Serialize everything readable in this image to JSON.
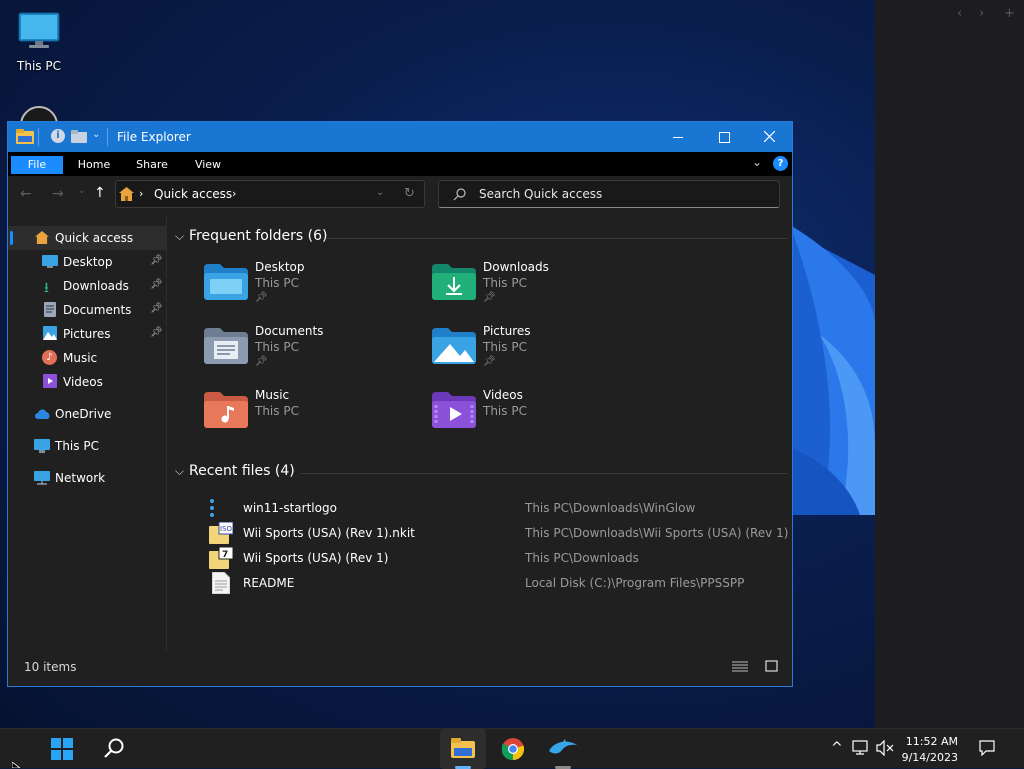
{
  "desktop": {
    "icons": [
      {
        "label": "This PC"
      }
    ]
  },
  "window": {
    "title": "File Explorer",
    "ribbon_tabs": {
      "file": "File",
      "home": "Home",
      "share": "Share",
      "view": "View"
    },
    "address_crumb": "Quick access",
    "search_placeholder": "Search Quick access",
    "status": "10 items"
  },
  "sidebar": {
    "items": [
      {
        "label": "Quick access",
        "icon": "home-icon",
        "color": "#e8a33d"
      },
      {
        "label": "Desktop",
        "icon": "desktop-icon",
        "color": "#3aa3e3",
        "pinned": true
      },
      {
        "label": "Downloads",
        "icon": "download-icon",
        "color": "#2dbf7a",
        "pinned": true
      },
      {
        "label": "Documents",
        "icon": "documents-icon",
        "color": "#9aa7b8",
        "pinned": true
      },
      {
        "label": "Pictures",
        "icon": "pictures-icon",
        "color": "#3aa3e3",
        "pinned": true
      },
      {
        "label": "Music",
        "icon": "music-icon",
        "color": "#e27058"
      },
      {
        "label": "Videos",
        "icon": "videos-icon",
        "color": "#8b52d9"
      },
      {
        "label": "OneDrive",
        "icon": "onedrive-icon",
        "color": "#2a86e0"
      },
      {
        "label": "This PC",
        "icon": "this-pc-icon",
        "color": "#3aa3e3"
      },
      {
        "label": "Network",
        "icon": "network-icon",
        "color": "#3aa3e3"
      }
    ]
  },
  "frequent": {
    "heading": "Frequent folders (6)",
    "folders": [
      {
        "name": "Desktop",
        "location": "This PC",
        "pinned": true,
        "icon": "desktop-folder-icon",
        "color": "#3aa3e3"
      },
      {
        "name": "Downloads",
        "location": "This PC",
        "pinned": true,
        "icon": "downloads-folder-icon",
        "color": "#22b07a"
      },
      {
        "name": "Documents",
        "location": "This PC",
        "pinned": true,
        "icon": "documents-folder-icon",
        "color": "#8d9bb0"
      },
      {
        "name": "Pictures",
        "location": "This PC",
        "pinned": true,
        "icon": "pictures-folder-icon",
        "color": "#3aa3e3"
      },
      {
        "name": "Music",
        "location": "This PC",
        "pinned": false,
        "icon": "music-folder-icon",
        "color": "#e8785a"
      },
      {
        "name": "Videos",
        "location": "This PC",
        "pinned": false,
        "icon": "videos-folder-icon",
        "color": "#8b52d9"
      }
    ]
  },
  "recent": {
    "heading": "Recent files (4)",
    "files": [
      {
        "name": "win11-startlogo",
        "path": "This PC\\Downloads\\WinGlow",
        "icon": "generic-file-icon"
      },
      {
        "name": "Wii Sports (USA) (Rev 1).nkit",
        "path": "This PC\\Downloads\\Wii Sports (USA) (Rev 1)",
        "icon": "iso-file-icon"
      },
      {
        "name": "Wii Sports (USA) (Rev 1)",
        "path": "This PC\\Downloads",
        "icon": "archive-file-icon"
      },
      {
        "name": "README",
        "path": "Local Disk (C:)\\Program Files\\PPSSPP",
        "icon": "text-file-icon"
      }
    ]
  },
  "taskbar": {
    "apps": [
      "start-icon",
      "search-icon",
      "file-explorer-icon",
      "chrome-icon",
      "dolphin-icon"
    ],
    "time": "11:52 AM",
    "date": "9/14/2023"
  },
  "colors": {
    "accent": "#1976d2",
    "window_bg": "#202020",
    "file_tab": "#1a8cff"
  }
}
